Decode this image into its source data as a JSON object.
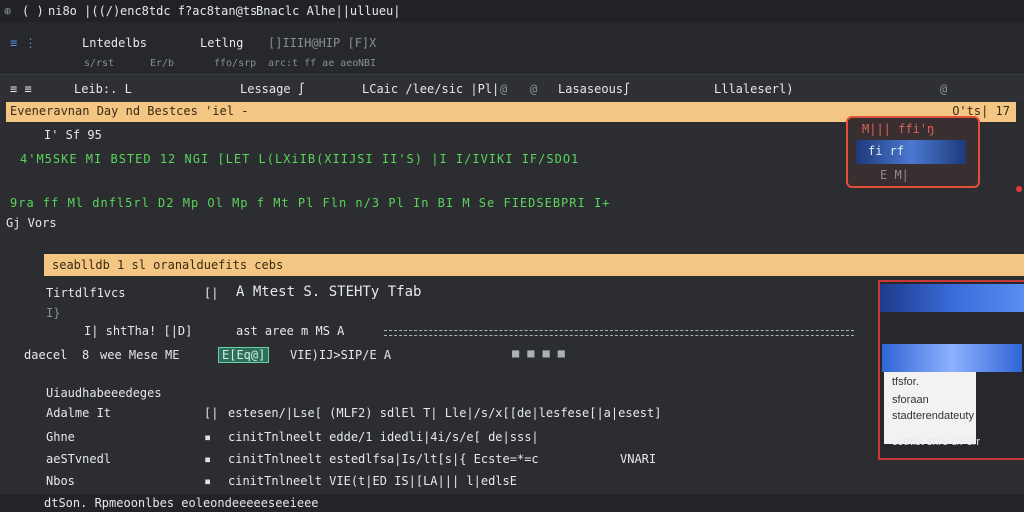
{
  "title_bar": {
    "items": [
      "⊕",
      "( )",
      "ni8o |((/)",
      "enc8tdc f?ac8tan@ts",
      "Bnaclc Alhe||ullueu|"
    ]
  },
  "toolbar": {
    "row1": [
      "≡ ⋮",
      "Lntedelbs",
      "Letlng",
      "[]IIIH@HIP [F]X"
    ],
    "row2": [
      "s/rst",
      "Er/b",
      "ffo/srp",
      "arc:t ff ae aeo",
      "NBI"
    ]
  },
  "nav": {
    "items": [
      "≡ ≡",
      "Leib:. L",
      "Lessage ∫",
      "LCaic /lee/sic |Pl|",
      "Lasaseous∫",
      "Lllaleserl)"
    ],
    "icons": [
      "@",
      "@",
      "@"
    ]
  },
  "banner": {
    "text": "Eveneravnan Day nd Bestces 'iel -",
    "right": "O'ts| 17"
  },
  "code_lines": [
    "I' Sf 95",
    "4'M5SKE MI BSTED 12 NGI [LET L(LXiIB(XIIJSI II'S) |I I/IVIKI IF/SDO1",
    "9ra ff Ml dnfl5rl D2 Mp Ol Mp f Mt Pl Fln n/3 Pl In BI M Se FIEDSEBPRI I+"
  ],
  "popup": {
    "top": "M||| ffi'ŋ",
    "mid": "fi  rf",
    "bottom": "E  M|"
  },
  "strip": {
    "label": "Gj Vors"
  },
  "section": {
    "title": "seablldb  1 sl oranalduefits cebs"
  },
  "details": {
    "label1": "Tirtdlf1vcs",
    "marker1": "[|",
    "value1": "A Mtest S. STEHTy Tfab",
    "sub": "I}",
    "label2": "I| shtTha! [|D]",
    "value2": "ast aree m  MS   A",
    "row_label": "daecel",
    "row_num": "8",
    "row_text": "wee Mese  ME",
    "row_highlight": "E[Eq@]",
    "row_value": "VIE)IJ>SIP/E A"
  },
  "list": {
    "header": "Uiaudhabeeedeges",
    "rows": [
      {
        "name": "Adalme It",
        "mark": "[|",
        "text": "estesen/|Lse[ (MLF2) sdlEl T|  Lle|/s/x[[de|lesfese[|a|esest]"
      },
      {
        "name": "Ghne",
        "mark": "▪",
        "text": "cinitTnlneelt  edde/1 idedli|4i/s/e[  de|sss|"
      },
      {
        "name": "aeSTvnedl",
        "mark": "▪",
        "text": "cinitTnlneelt  estedlfsa|Is/lt[s|{  Ecste=*=c",
        "extra": "VNARI"
      },
      {
        "name": "Nbos",
        "mark": "▪",
        "text": "cinitTnlneelt  VIE(t|ED IS|[LA|||  l|edlsE"
      }
    ]
  },
  "side_menu": {
    "items": [
      "tfsfor.",
      "sforaan",
      "stadterendateuty",
      "cothist shre c/Ferr"
    ]
  },
  "statusbar": {
    "text": "dtSon.  Rpmeoonlbes  eoleondeeeeeseeieee"
  },
  "colors": {
    "accent_yellow": "#f3c684",
    "green": "#5ad45a",
    "red": "#e0503a",
    "blue": "#3a6ad8",
    "bg": "#2b2d31"
  }
}
